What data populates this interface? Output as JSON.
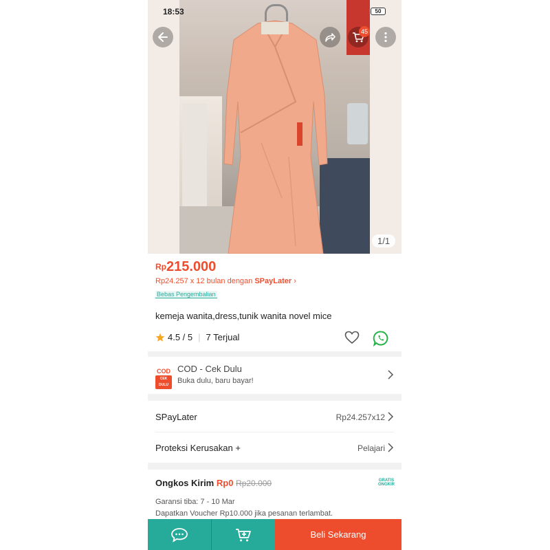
{
  "status_bar": {
    "time": "18:53",
    "battery": "50"
  },
  "header": {
    "cart_count": "45",
    "icons": [
      "back-arrow-icon",
      "share-icon",
      "cart-icon",
      "more-icon"
    ]
  },
  "gallery": {
    "counter": "1/1"
  },
  "product": {
    "currency": "Rp",
    "price": "215.000",
    "installment_text": "Rp24.257 x 12 bulan dengan ",
    "installment_brand": "SPayLater",
    "installment_chevron": "›",
    "return_badge": "Bebas Pengembalian",
    "title": "kemeja wanita,dress,tunik wanita novel mice",
    "rating": "4.5 / 5",
    "sold": "7 Terjual"
  },
  "cod": {
    "logo_main": "COD",
    "logo_sub": "CEK DULU",
    "title": "COD - Cek Dulu",
    "subtitle": "Buka dulu, baru bayar!"
  },
  "spaylater": {
    "label": "SPayLater",
    "value": "Rp24.257x12"
  },
  "protection": {
    "label": "Proteksi Kerusakan +",
    "value": "Pelajari"
  },
  "shipping": {
    "label": "Ongkos Kirim ",
    "free": "Rp0",
    "old": "Rp20.000",
    "badge_top": "GRATIS",
    "badge_bottom": "ONGKIR",
    "guarantee": "Garansi tiba: 7 - 10 Mar",
    "voucher": "Dapatkan Voucher Rp10.000 jika pesanan terlambat."
  },
  "bottom_bar": {
    "buy_label": "Beli Sekarang"
  },
  "colors": {
    "accent": "#ee4d2d",
    "teal": "#26aa99"
  }
}
